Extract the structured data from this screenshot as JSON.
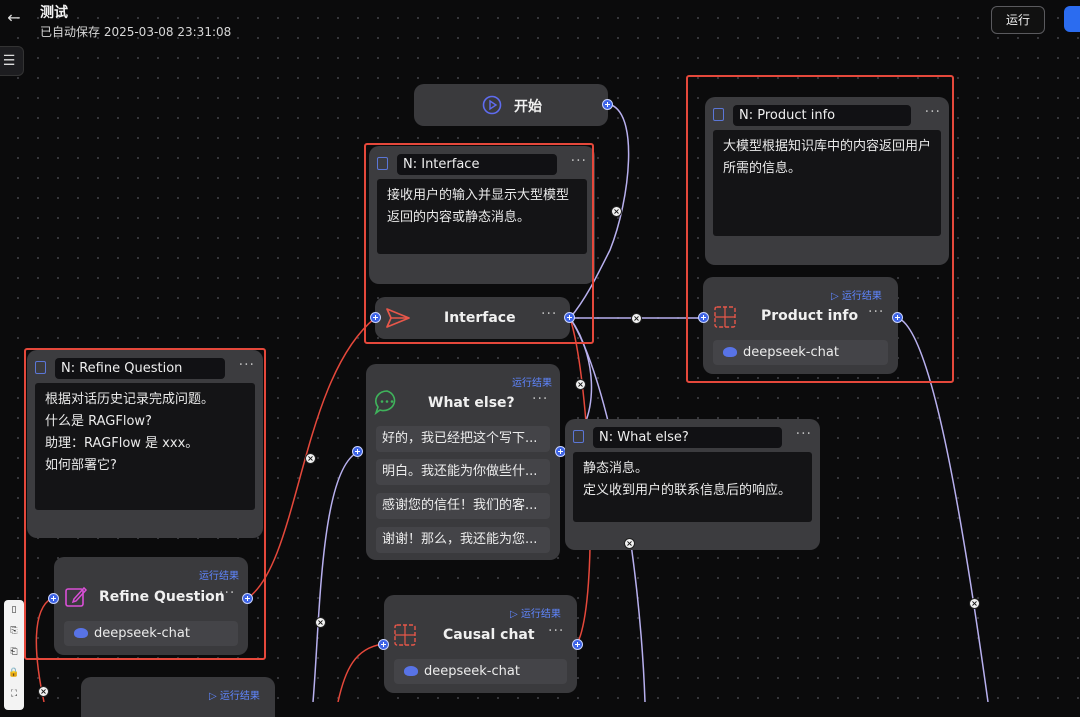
{
  "header": {
    "title": "测试",
    "autosave": "已自动保存 2025-03-08 23:31:08",
    "run_label": "运行"
  },
  "colors": {
    "accent": "#3d63e6",
    "frame": "#e5483b",
    "edge_purple": "#b8b0ef",
    "edge_red": "#e5483b"
  },
  "nodes": {
    "start": {
      "label": "开始"
    },
    "interface": {
      "label": "Interface"
    },
    "what_else": {
      "label": "What else?",
      "run_result": "运行结果",
      "options": [
        "好的，我已经把这个写下...",
        "明白。我还能为你做些什...",
        "感谢您的信任！我们的客...",
        "谢谢！那么，我还能为您..."
      ]
    },
    "product_info": {
      "label": "Product info",
      "run_result": "运行结果",
      "model": "deepseek-chat"
    },
    "refine_question": {
      "label": "Refine Question",
      "run_result": "运行结果",
      "model": "deepseek-chat"
    },
    "causal_chat": {
      "label": "Causal chat",
      "run_result": "运行结果",
      "model": "deepseek-chat"
    },
    "partial_bottom": {
      "run_result": "运行结果"
    }
  },
  "notes": {
    "interface": {
      "title": "N: Interface",
      "body": "接收用户的输入并显示大型模型返回的内容或静态消息。"
    },
    "product_info": {
      "title": "N: Product info",
      "body": "大模型根据知识库中的内容返回用户所需的信息。"
    },
    "refine_question": {
      "title": "N: Refine Question",
      "lines": [
        "根据对话历史记录完成问题。",
        "什么是 RAGFlow?",
        "助理：RAGFlow 是 xxx。",
        "如何部署它?"
      ]
    },
    "what_else": {
      "title": "N: What else?",
      "lines": [
        "静态消息。",
        "定义收到用户的联系信息后的响应。"
      ]
    }
  }
}
